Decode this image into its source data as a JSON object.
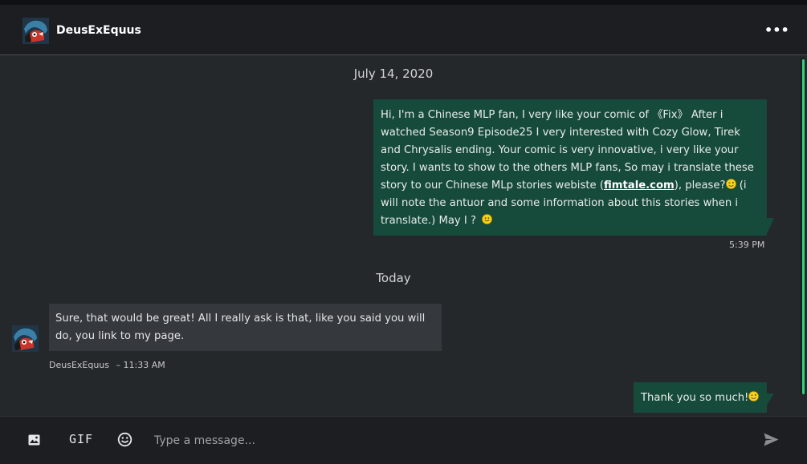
{
  "header": {
    "username": "DeusExEquus",
    "menu_label": "•••"
  },
  "conversation": {
    "date_separator_1": "July 14, 2020",
    "outgoing_message_1": {
      "text_before_link": "Hi, I'm a Chinese MLP fan, I very like your comic of 《Fix》 After i watched Season9 Episode25 I very interested with Cozy Glow, Tirek and Chrysalis ending. Your comic is very innovative, i very like your story. I wants to show to the others MLP fans, So may i translate these story to our Chinese MLp stories webiste (",
      "link_text": "fimtale.com",
      "text_after_link": "), please?",
      "text_after_emoji": " (i will note the antuor and some information about this stories when i translate.) May I ? ",
      "time": "5:39 PM"
    },
    "date_separator_2": "Today",
    "incoming_message_1": {
      "text": "Sure, that would be great! All I really ask is that, like you said you will do, you link to my page.",
      "author": "DeusExEquus",
      "time": "– 11:33 AM"
    },
    "outgoing_message_2": {
      "text": "Thank you so much!"
    }
  },
  "composer": {
    "gif_label": "GIF",
    "placeholder": "Type a message..."
  },
  "colors": {
    "background": "#25282b",
    "header": "#1c1e21",
    "outgoing_bubble": "#164a3a",
    "incoming_bubble": "#35383c",
    "scrollbar_accent": "#33d17a"
  },
  "icons": [
    "avatar",
    "more-dots-icon",
    "image-icon",
    "gif-icon",
    "emoji-icon",
    "send-icon",
    "winking-emoji",
    "smiley-emoji"
  ]
}
